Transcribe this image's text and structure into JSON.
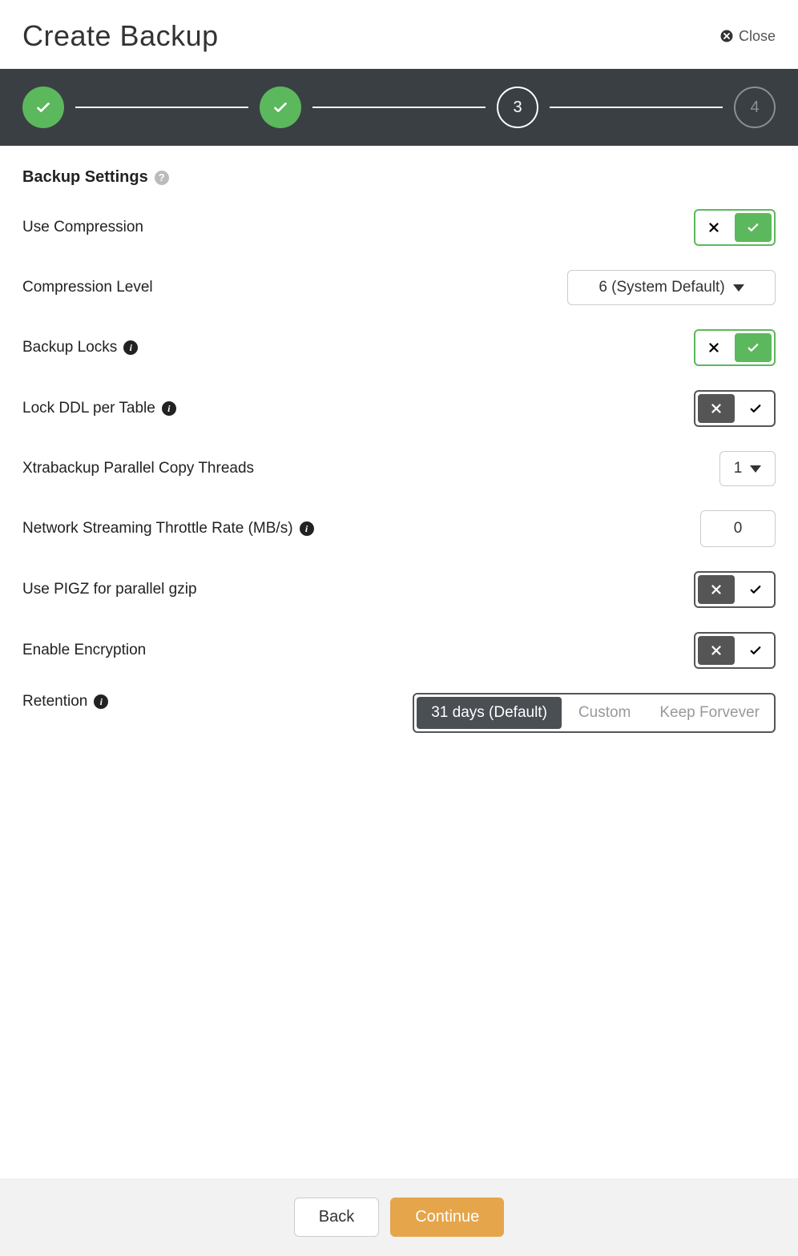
{
  "header": {
    "title": "Create Backup",
    "close_label": "Close"
  },
  "stepper": {
    "steps": [
      {
        "state": "done"
      },
      {
        "state": "done"
      },
      {
        "state": "current",
        "label": "3"
      },
      {
        "state": "future",
        "label": "4"
      }
    ]
  },
  "section_title": "Backup Settings",
  "rows": {
    "use_compression": {
      "label": "Use Compression",
      "toggle": true
    },
    "compression_level": {
      "label": "Compression Level",
      "value": "6 (System Default)"
    },
    "backup_locks": {
      "label": "Backup Locks",
      "toggle": true
    },
    "lock_ddl": {
      "label": "Lock DDL per Table",
      "toggle": false
    },
    "xtrabackup_threads": {
      "label": "Xtrabackup Parallel Copy Threads",
      "value": "1"
    },
    "throttle": {
      "label": "Network Streaming Throttle Rate (MB/s)",
      "value": "0"
    },
    "pigz": {
      "label": "Use PIGZ for parallel gzip",
      "toggle": false
    },
    "encryption": {
      "label": "Enable Encryption",
      "toggle": false
    },
    "retention": {
      "label": "Retention",
      "options": [
        "31 days (Default)",
        "Custom",
        "Keep Forvever"
      ],
      "selected": 0
    }
  },
  "footer": {
    "back": "Back",
    "continue": "Continue"
  }
}
